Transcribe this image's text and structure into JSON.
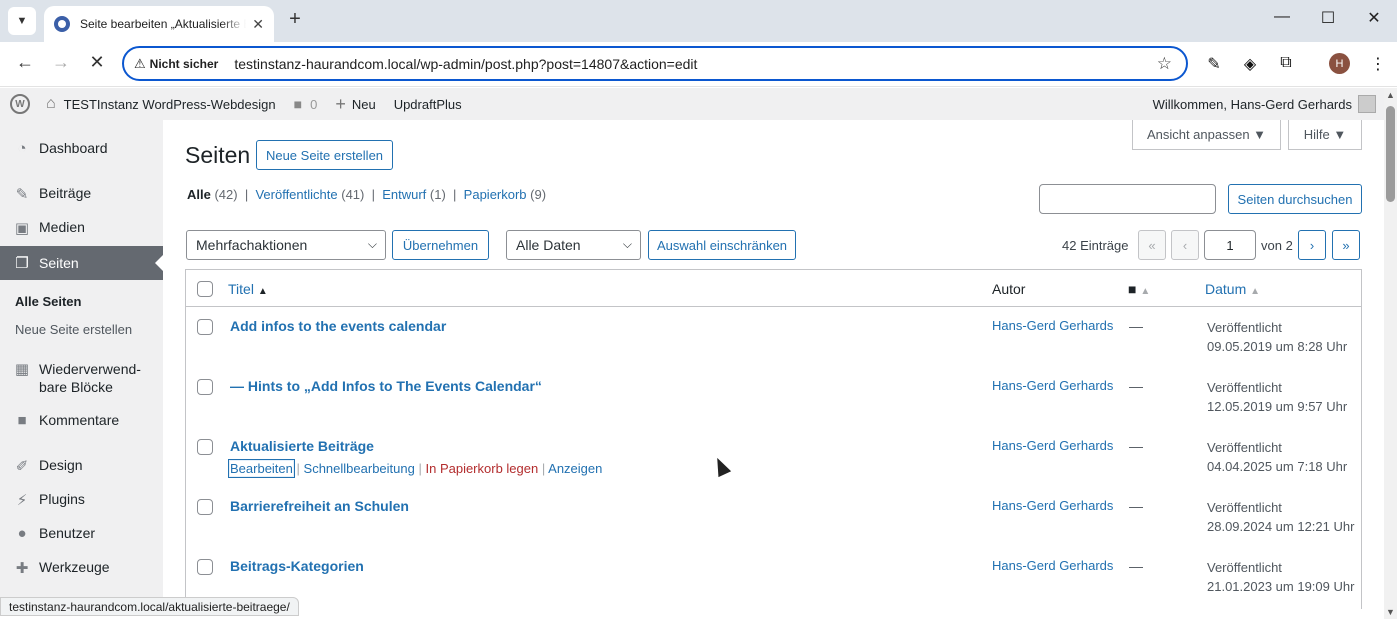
{
  "browser": {
    "tab_title": "Seite bearbeiten „Aktualisierte Beiträge“",
    "tab_close": "✕",
    "new_tab": "+",
    "minimize": "—",
    "maximize": "☐",
    "close": "✕",
    "back": "←",
    "forward": "→",
    "stop": "✕",
    "security_warning": "Nicht sicher",
    "url": "testinstanz-haurandcom.local/wp-admin/post.php?post=14807&action=edit",
    "profile_initial": "H",
    "status_url": "testinstanz-haurandcom.local/aktualisierte-beitraege/"
  },
  "adminbar": {
    "site_name": "TESTInstanz WordPress-Webdesign",
    "comments_count": "0",
    "new_label": "Neu",
    "plugin_label": "UpdraftPlus",
    "welcome": "Willkommen, Hans-Gerd Gerhards"
  },
  "sidebar": {
    "dashboard": "Dashboard",
    "beitraege": "Beiträge",
    "medien": "Medien",
    "seiten": "Seiten",
    "sub_alle": "Alle Seiten",
    "sub_neu": "Neue Seite erstellen",
    "bloecke_1": "Wiederverwend-",
    "bloecke_2": "bare Blöcke",
    "kommentare": "Kommentare",
    "design": "Design",
    "plugins": "Plugins",
    "benutzer": "Benutzer",
    "werkzeuge": "Werkzeuge"
  },
  "header": {
    "screen_options": "Ansicht anpassen ▼",
    "help": "Hilfe ▼",
    "title": "Seiten",
    "add_new": "Neue Seite erstellen"
  },
  "filters": {
    "all": "Alle",
    "all_count": "(42)",
    "published": "Veröffentlichte",
    "published_count": "(41)",
    "draft": "Entwurf",
    "draft_count": "(1)",
    "trash": "Papierkorb",
    "trash_count": "(9)",
    "sep": "|"
  },
  "search": {
    "button": "Seiten durchsuchen",
    "value": ""
  },
  "bulk": {
    "actions": "Mehrfachaktionen",
    "apply": "Übernehmen",
    "dates": "Alle Daten",
    "filter": "Auswahl einschränken"
  },
  "pagination": {
    "count": "42 Einträge",
    "first": "«",
    "prev": "‹",
    "current": "1",
    "of": "von 2",
    "next": "›",
    "last": "»"
  },
  "table": {
    "col_title": "Titel",
    "col_author": "Autor",
    "col_date": "Datum",
    "rows": [
      {
        "title": "Add infos to the events calendar",
        "author": "Hans-Gerd Gerhards",
        "comments": "—",
        "status": "Veröffentlicht",
        "date": "09.05.2019 um 8:28 Uhr"
      },
      {
        "title": "— Hints to „Add Infos to The Events Calendar“",
        "author": "Hans-Gerd Gerhards",
        "comments": "—",
        "status": "Veröffentlicht",
        "date": "12.05.2019 um 9:57 Uhr"
      },
      {
        "title": "Aktualisierte Beiträge",
        "author": "Hans-Gerd Gerhards",
        "comments": "—",
        "status": "Veröffentlicht",
        "date": "04.04.2025 um 7:18 Uhr"
      },
      {
        "title": "Barrierefreiheit an Schulen",
        "author": "Hans-Gerd Gerhards",
        "comments": "—",
        "status": "Veröffentlicht",
        "date": "28.09.2024 um 12:21 Uhr"
      },
      {
        "title": "Beitrags-Kategorien",
        "author": "Hans-Gerd Gerhards",
        "comments": "—",
        "status": "Veröffentlicht",
        "date": "21.01.2023 um 19:09 Uhr"
      }
    ],
    "row_actions": {
      "edit": "Bearbeiten",
      "quick_edit": "Schnellbearbeitung",
      "trash": "In Papierkorb legen",
      "view": "Anzeigen",
      "sep": "|"
    }
  }
}
